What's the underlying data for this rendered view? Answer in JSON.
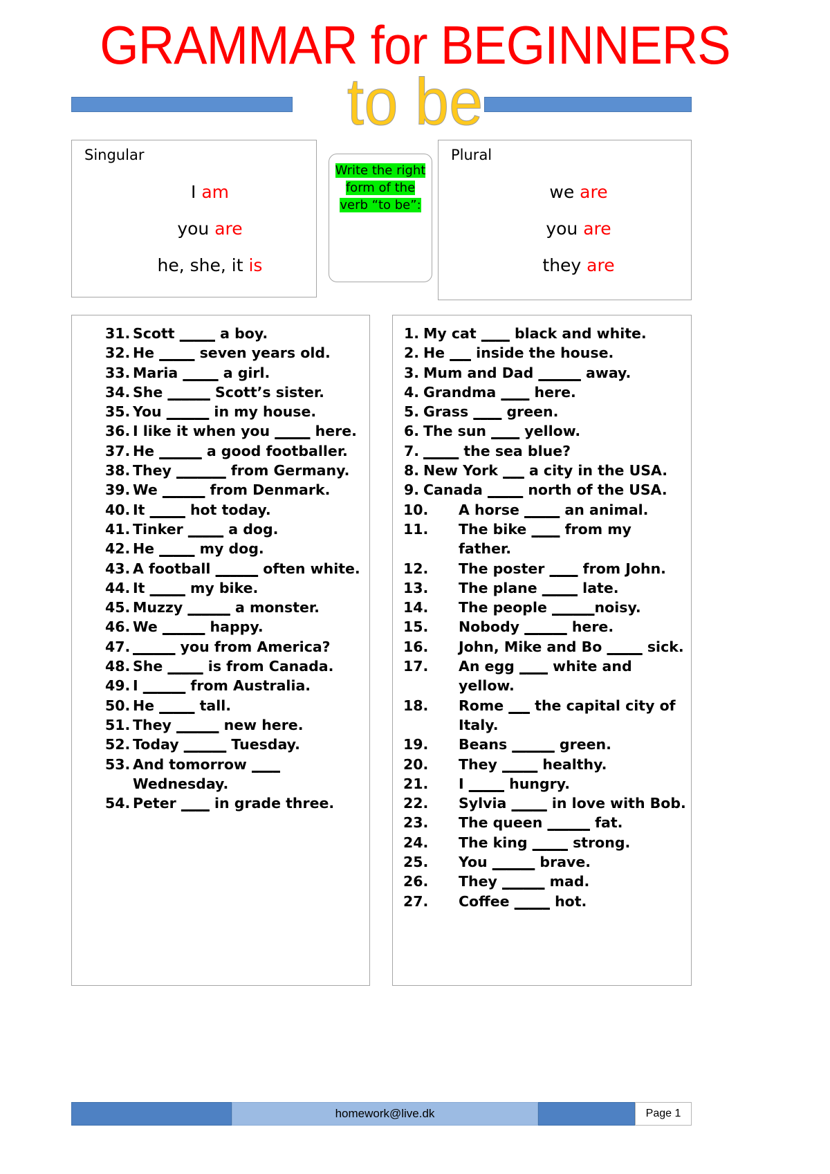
{
  "title": {
    "main": "GRAMMAR for BEGINNERS",
    "sub": "to be",
    "main_color": "#ff0000",
    "sub_color": "#ffc91e",
    "bar_color": "#5b8fd1"
  },
  "instruction": {
    "text": "Write the right form of the verb “to be”:",
    "highlight_color": "#00ee00"
  },
  "conjugation": {
    "singular": {
      "label": "Singular",
      "lines": [
        {
          "pronoun": "I",
          "verb": "am"
        },
        {
          "pronoun": "you",
          "verb": "are"
        },
        {
          "pronoun": "he, she, it",
          "verb": "is"
        }
      ]
    },
    "plural": {
      "label": "Plural",
      "lines": [
        {
          "pronoun": "we",
          "verb": "are"
        },
        {
          "pronoun": "you",
          "verb": "are"
        },
        {
          "pronoun": "they",
          "verb": "are"
        }
      ]
    },
    "verb_color": "#ff0000"
  },
  "exercises": {
    "left_column": [
      {
        "num": "31.",
        "text": "Scott _____ a boy."
      },
      {
        "num": "32.",
        "text": "He _____ seven years old."
      },
      {
        "num": "33.",
        "text": "Maria _____ a girl."
      },
      {
        "num": "34.",
        "text": "She ______ Scott’s sister."
      },
      {
        "num": "35.",
        "text": "You ______ in my house."
      },
      {
        "num": "36.",
        "text": "I like it when you _____ here."
      },
      {
        "num": "37.",
        "text": "He ______ a good footballer."
      },
      {
        "num": "38.",
        "text": "They _______ from Germany."
      },
      {
        "num": "39.",
        "text": "We ______ from Denmark."
      },
      {
        "num": "40.",
        "text": "It _____ hot today."
      },
      {
        "num": "41.",
        "text": "Tinker _____ a dog."
      },
      {
        "num": "42.",
        "text": "He _____ my dog."
      },
      {
        "num": "43.",
        "text": "A football ______ often white."
      },
      {
        "num": "44.",
        "text": "It _____ my bike."
      },
      {
        "num": "45.",
        "text": "Muzzy ______ a monster."
      },
      {
        "num": "46.",
        "text": "We ______ happy."
      },
      {
        "num": "47.",
        "text": "______ you from America?"
      },
      {
        "num": "48.",
        "text": "She _____ is from Canada."
      },
      {
        "num": "49.",
        "text": "I ______ from Australia."
      },
      {
        "num": "50.",
        "text": "He _____ tall."
      },
      {
        "num": "51.",
        "text": "They ______ new here."
      },
      {
        "num": "52.",
        "text": "Today ______ Tuesday."
      },
      {
        "num": "53.",
        "text": "And tomorrow ____ Wednesday."
      },
      {
        "num": "54.",
        "text": "Peter ____ in grade three."
      }
    ],
    "right_column": [
      {
        "num": "1.",
        "text": "My cat ____ black and white.",
        "indent": "narrow"
      },
      {
        "num": "2.",
        "text": "He ___ inside the house.",
        "indent": "narrow"
      },
      {
        "num": "3.",
        "text": "Mum and Dad ______ away.",
        "indent": "narrow"
      },
      {
        "num": "4.",
        "text": "Grandma ____ here.",
        "indent": "narrow"
      },
      {
        "num": "5.",
        "text": "Grass ____ green.",
        "indent": "narrow"
      },
      {
        "num": "6.",
        "text": "The sun ____ yellow.",
        "indent": "narrow"
      },
      {
        "num": "7.",
        "text": "_____ the sea blue?",
        "indent": "narrow"
      },
      {
        "num": "8.",
        "text": "New York ___ a city in the USA.",
        "indent": "narrow"
      },
      {
        "num": "9.",
        "text": "Canada _____ north of the USA.",
        "indent": "narrow"
      },
      {
        "num": "10.",
        "text": "A horse _____ an animal.",
        "indent": "wide"
      },
      {
        "num": "11.",
        "text": "The bike ____ from my father.",
        "indent": "wide"
      },
      {
        "num": "12.",
        "text": "The poster ____ from John.",
        "indent": "wide"
      },
      {
        "num": "13.",
        "text": "The plane _____ late.",
        "indent": "wide"
      },
      {
        "num": "14.",
        "text": "The people ______noisy.",
        "indent": "wide"
      },
      {
        "num": "15.",
        "text": "Nobody ______ here.",
        "indent": "wide"
      },
      {
        "num": "16.",
        "text": "John, Mike and Bo _____ sick.",
        "indent": "wide"
      },
      {
        "num": "17.",
        "text": "An egg ____ white and yellow.",
        "indent": "wide"
      },
      {
        "num": "18.",
        "text": "Rome ___ the capital city of Italy.",
        "indent": "wide"
      },
      {
        "num": "19.",
        "text": "Beans ______ green.",
        "indent": "wide"
      },
      {
        "num": "20.",
        "text": "They _____ healthy.",
        "indent": "wide"
      },
      {
        "num": "21.",
        "text": "I _____ hungry.",
        "indent": "wide"
      },
      {
        "num": "22.",
        "text": "Sylvia _____ in love with Bob.",
        "indent": "wide"
      },
      {
        "num": "23.",
        "text": "The queen ______ fat.",
        "indent": "wide"
      },
      {
        "num": "24.",
        "text": "The king _____ strong.",
        "indent": "wide"
      },
      {
        "num": "25.",
        "text": "You ______ brave.",
        "indent": "wide"
      },
      {
        "num": "26.",
        "text": "They ______ mad.",
        "indent": "wide"
      },
      {
        "num": "27.",
        "text": "Coffee _____ hot.",
        "indent": "wide"
      }
    ]
  },
  "footer": {
    "email": "homework@live.dk",
    "page": "Page 1",
    "dark_color": "#4e81c3",
    "light_color": "#9cbbe3"
  }
}
